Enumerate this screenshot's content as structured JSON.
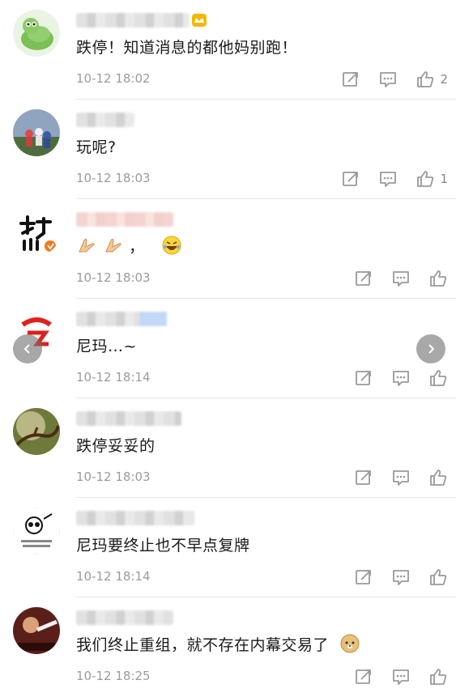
{
  "comments": [
    {
      "text": "跌停！知道消息的都他妈别跑！",
      "time": "10-12 18:02",
      "likes": "2",
      "avatar": "turtle-avatar"
    },
    {
      "text": "玩呢?",
      "time": "10-12 18:03",
      "likes": "1",
      "avatar": "crowd-avatar"
    },
    {
      "text": "，",
      "time": "10-12 18:03",
      "likes": "",
      "avatar": "calligraphy-avatar"
    },
    {
      "text": "尼玛…~",
      "time": "10-12 18:14",
      "likes": "",
      "avatar": "red-logo-avatar"
    },
    {
      "text": "跌停妥妥的",
      "time": "10-12 18:03",
      "likes": "",
      "avatar": "branch-avatar"
    },
    {
      "text": "尼玛要终止也不早点复牌",
      "time": "10-12 18:14",
      "likes": "",
      "avatar": "panda-avatar"
    },
    {
      "text": "我们终止重组，就不存在内幕交易了",
      "time": "10-12 18:25",
      "likes": "",
      "avatar": "photo-avatar"
    }
  ],
  "icons": {
    "share": "share-icon",
    "comment": "comment-icon",
    "like": "thumbs-up-icon",
    "prev": "chevron-left-icon",
    "next": "chevron-right-icon"
  },
  "colors": {
    "divider": "#e6e6e6",
    "time": "#9b9b9b",
    "icon": "#999999"
  }
}
